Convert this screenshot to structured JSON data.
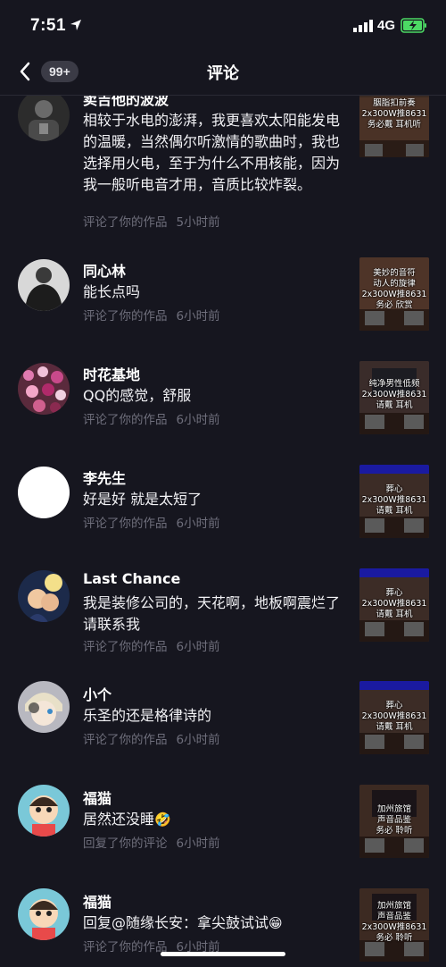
{
  "status_bar": {
    "time": "7:51",
    "network": "4G",
    "battery_color": "#4cd964"
  },
  "nav": {
    "badge": "99+",
    "title": "评论"
  },
  "comments": [
    {
      "user": "卖吉他的波波",
      "text": "相较于水电的澎湃，我更喜欢太阳能发电的温暖，当然偶尔听激情的歌曲时，我也选择用火电，至于为什么不用核能，因为我一般听电音才用，音质比较炸裂。",
      "action": "评论了你的作品",
      "time": "5小时前",
      "thumb": [
        "胭脂扣前奏",
        "2x300W推8631",
        "务必戴 耳机听"
      ],
      "avatar": "dark-person"
    },
    {
      "user": "同心林",
      "text": "能长点吗",
      "action": "评论了你的作品",
      "time": "6小时前",
      "thumb": [
        "美妙的音符",
        "动人的旋律",
        "2x300W推8631",
        "务必 欣赏"
      ],
      "avatar": "muscle-man"
    },
    {
      "user": "时花基地",
      "text": "QQ的感觉，舒服",
      "action": "评论了你的作品",
      "time": "6小时前",
      "thumb": [
        "纯净男性低频",
        "2x300W推8631",
        "请戴 耳机"
      ],
      "avatar": "flowers"
    },
    {
      "user": "李先生",
      "text": "好是好 就是太短了",
      "action": "评论了你的作品",
      "time": "6小时前",
      "thumb": [
        "葬心",
        "2x300W推8631",
        "请戴 耳机"
      ],
      "avatar": "white"
    },
    {
      "user": "Last Chance",
      "text": "我是装修公司的，天花啊，地板啊震烂了请联系我",
      "action": "评论了你的作品",
      "time": "6小时前",
      "thumb": [
        "葬心",
        "2x300W推8631",
        "请戴 耳机"
      ],
      "avatar": "couple"
    },
    {
      "user": "小个",
      "text": "乐圣的还是格律诗的",
      "action": "评论了你的作品",
      "time": "6小时前",
      "thumb": [
        "葬心",
        "2x300W推8631",
        "请戴 耳机"
      ],
      "avatar": "anime-boy"
    },
    {
      "user": "福猫",
      "text": "居然还没睡",
      "emoji": "🤣",
      "action": "回复了你的评论",
      "time": "6小时前",
      "thumb": [
        "加州旅馆",
        "声音品鉴",
        "务必 聆听"
      ],
      "avatar": "cartoon-kid"
    },
    {
      "user": "福猫",
      "text": "回复@随缘长安：拿尖鼓试试",
      "emoji": "😁",
      "action": "评论了你的作品",
      "time": "6小时前",
      "thumb": [
        "加州旅馆",
        "声音品鉴",
        "2x300W推8631",
        "务必 聆听"
      ],
      "avatar": "cartoon-kid"
    }
  ]
}
